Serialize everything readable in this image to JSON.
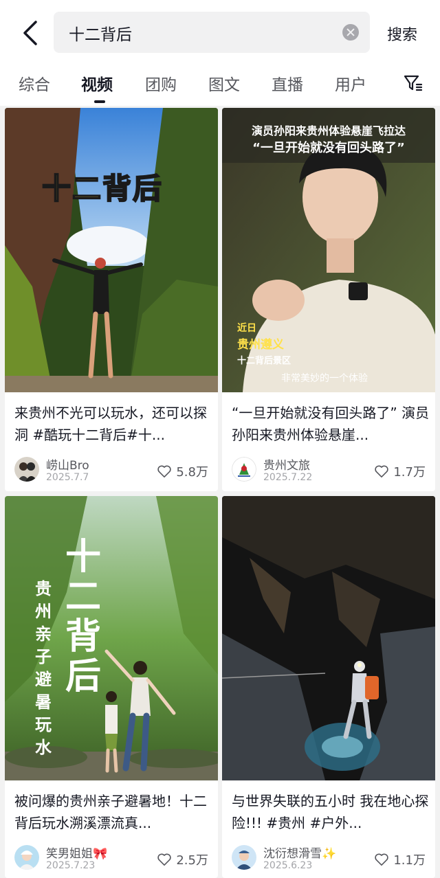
{
  "search": {
    "query": "十二背后",
    "button": "搜索"
  },
  "tabs": [
    "综合",
    "视频",
    "团购",
    "图文",
    "直播",
    "用户"
  ],
  "active_tab": "视频",
  "cards": [
    {
      "cover_text": "十二背后",
      "title": "来贵州不光可以玩水，还可以探洞 #酷玩十二背后#十...",
      "author": "崂山Bro",
      "date": "2025.7.7",
      "likes": "5.8万"
    },
    {
      "cover_caption_1": "演员孙阳来贵州体验悬崖飞拉达",
      "cover_caption_2": "“一旦开始就没有回头路了”",
      "cover_loc_1": "近日",
      "cover_loc_2": "贵州遵义",
      "cover_loc_3": "十二背后景区",
      "cover_sub": "非常美妙的一个体验",
      "title": "“一旦开始就没有回头路了” 演员孙阳来贵州体验悬崖...",
      "author": "贵州文旅",
      "date": "2025.7.22",
      "likes": "1.7万"
    },
    {
      "cover_big": "十二背后",
      "cover_vertical": "贵州亲子避暑玩水",
      "title": "被问爆的贵州亲子避暑地！十二背后玩水溯溪漂流真...",
      "author": "笑男姐姐🎀",
      "date": "2025.7.23",
      "likes": "2.5万"
    },
    {
      "title": "与世界失联的五小时 我在地心探险!!!  #贵州 #户外...",
      "author": "沈衍想滑雪✨",
      "date": "2025.6.23",
      "likes": "1.1万"
    }
  ],
  "colors": {
    "cover_title_yellow": "#ffe14a",
    "text_primary": "#161823",
    "text_secondary": "#56575d"
  },
  "icons": [
    "back-arrow-icon",
    "clear-icon",
    "filter-icon",
    "heart-icon"
  ]
}
